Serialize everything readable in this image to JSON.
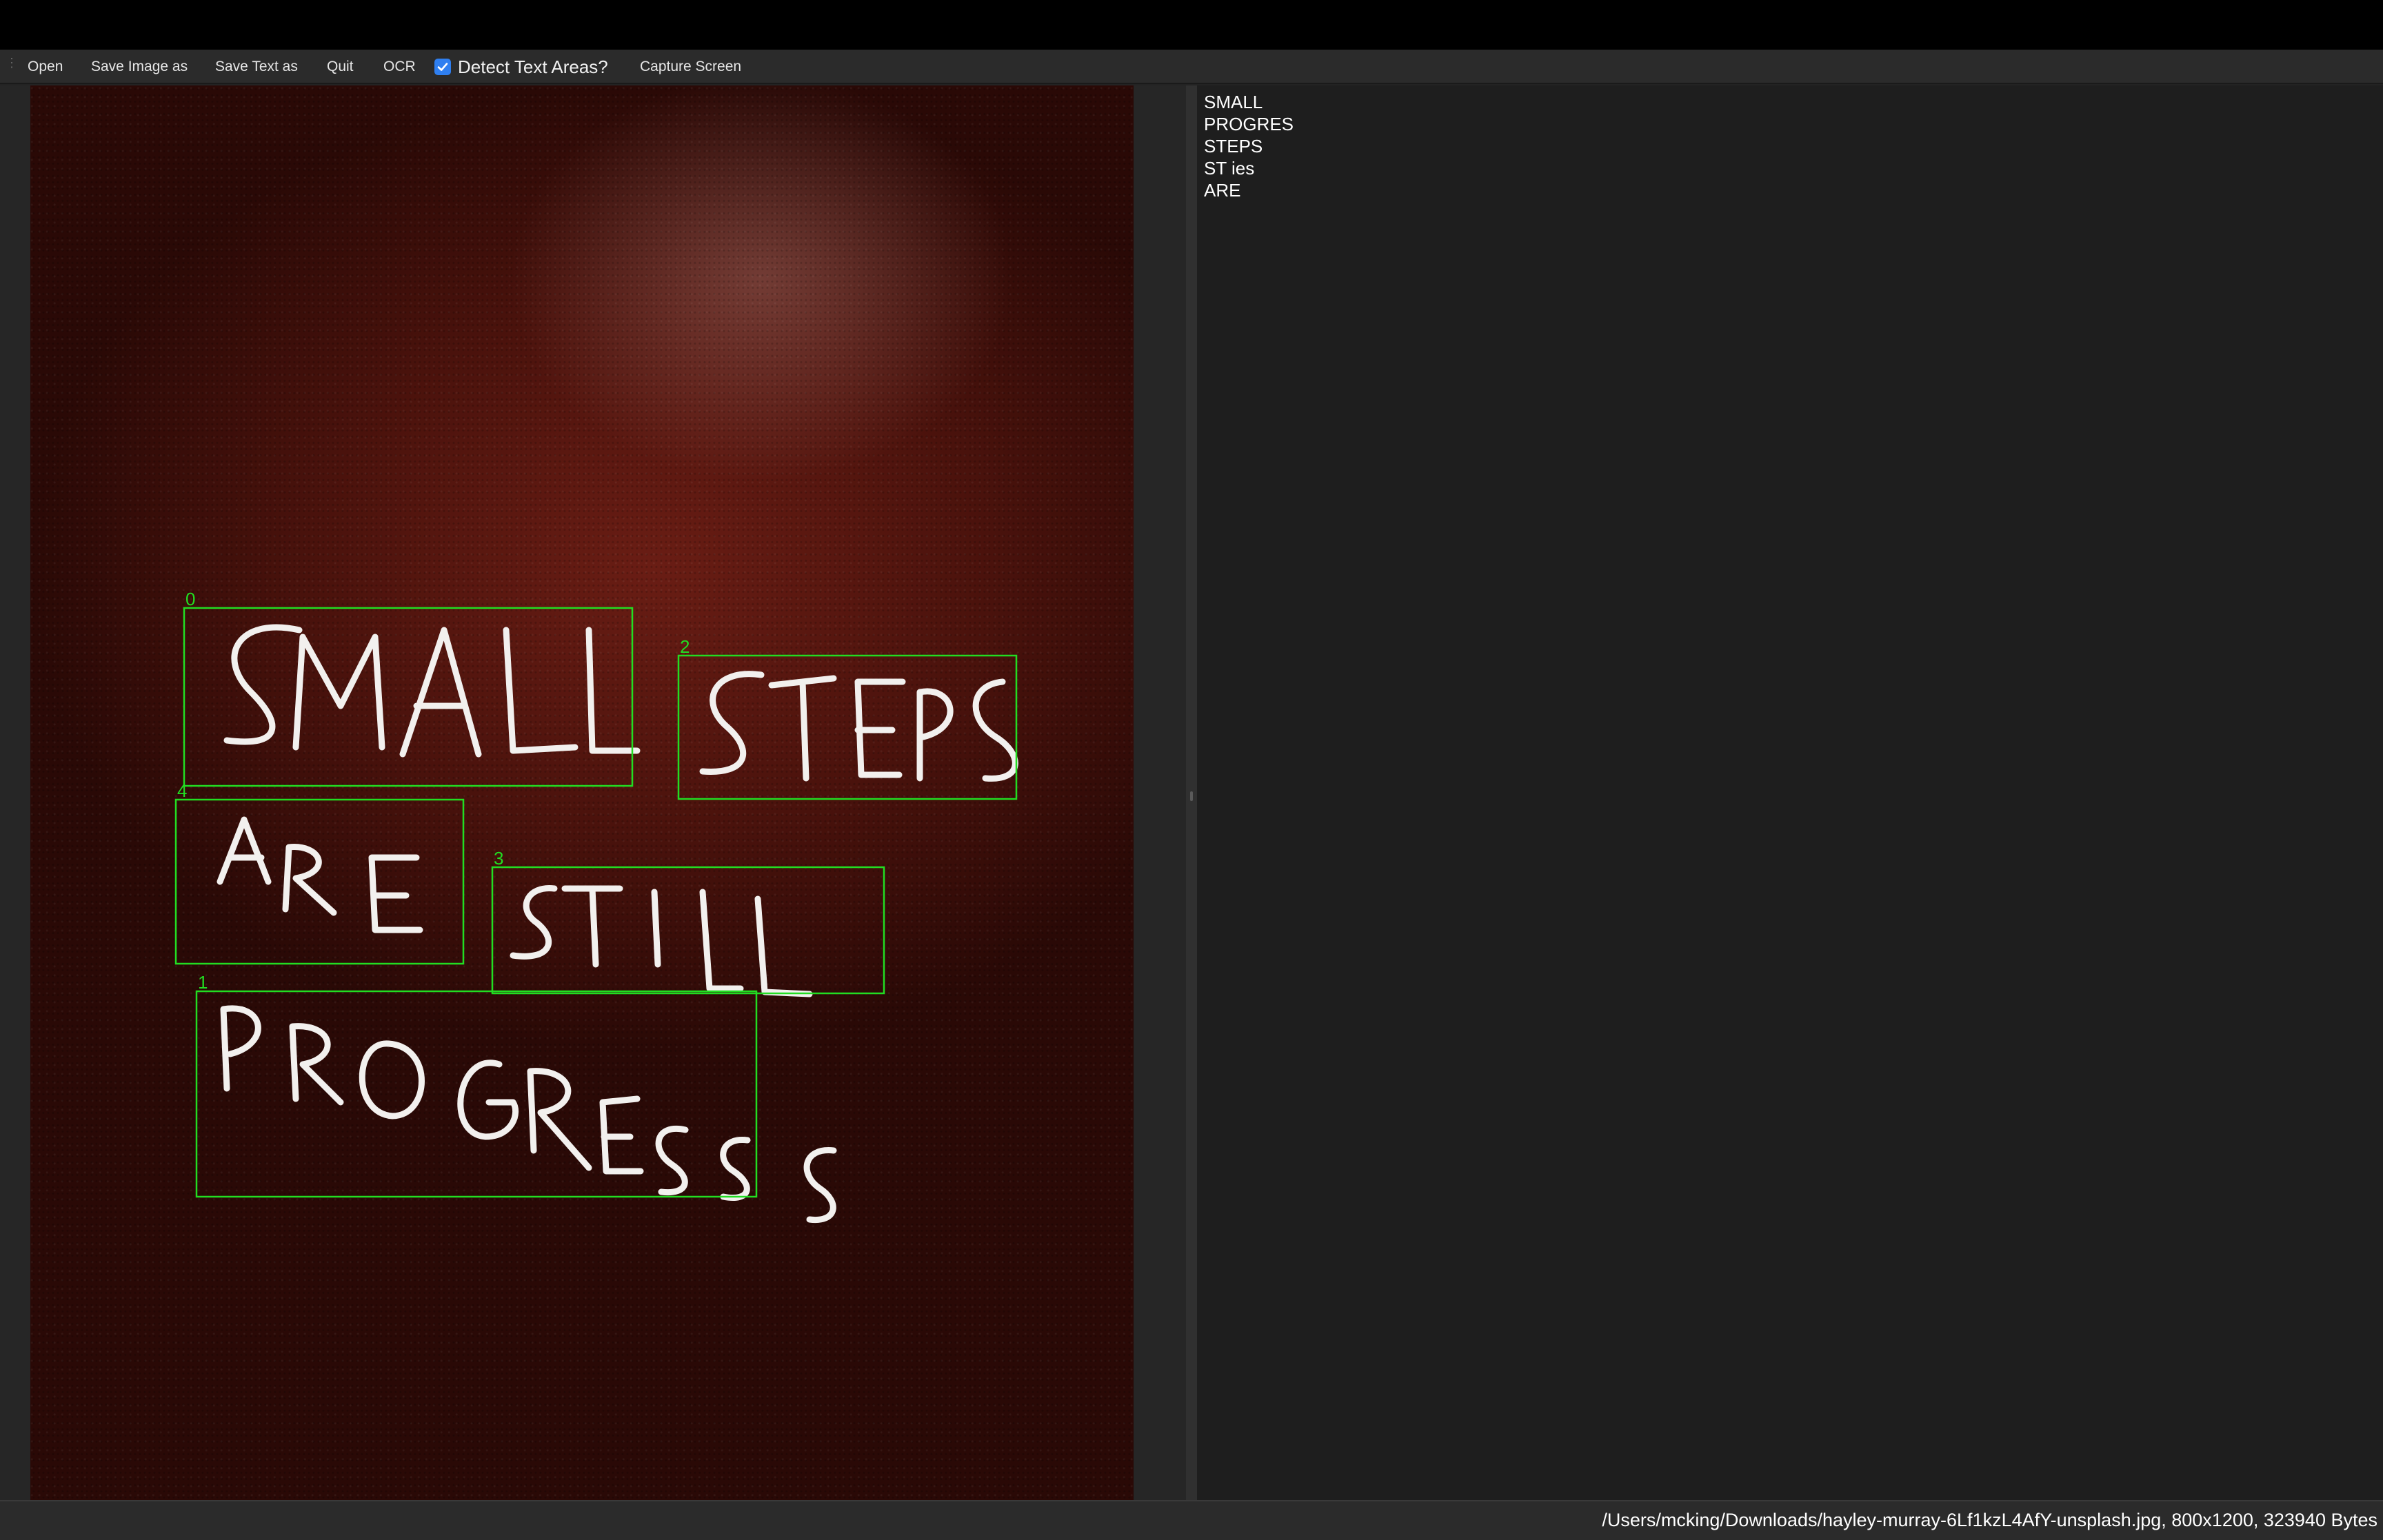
{
  "toolbar": {
    "buttons": [
      "Open",
      "Save Image as",
      "Save Text as",
      "Quit",
      "OCR"
    ],
    "detect_checkbox": {
      "label": "Detect Text Areas?",
      "checked": true
    },
    "capture_label": "Capture Screen"
  },
  "image": {
    "handwritten_text": [
      "SMALL",
      "STEPS",
      "ARE",
      "STILL",
      "PROGRESS"
    ],
    "regions": [
      {
        "index": "0",
        "word": "SMALL"
      },
      {
        "index": "1",
        "word": "PROGRESS"
      },
      {
        "index": "2",
        "word": "STEPS"
      },
      {
        "index": "3",
        "word": "STILL"
      },
      {
        "index": "4",
        "word": "ARE"
      }
    ],
    "box_color": "#22dd22",
    "chalk_color": "#f2f0ee"
  },
  "ocr_output": {
    "lines": [
      "SMALL",
      "PROGRES",
      "STEPS",
      "ST ies",
      "ARE"
    ]
  },
  "status": {
    "text": "/Users/mcking/Downloads/hayley-murray-6Lf1kzL4AfY-unsplash.jpg, 800x1200, 323940 Bytes"
  }
}
